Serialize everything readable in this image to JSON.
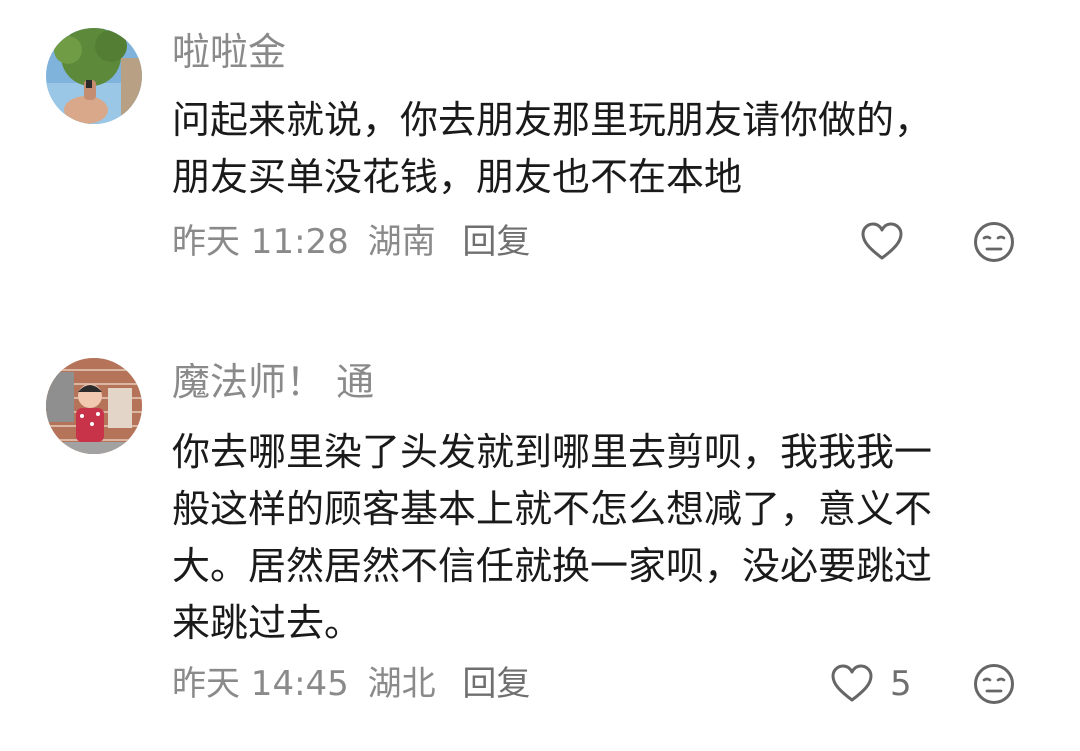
{
  "comments": [
    {
      "username": "啦啦金",
      "lines": [
        "问起来就说，你去朋友那里玩朋友请你做的，",
        "朋友买单没花钱，朋友也不在本地"
      ],
      "time": "昨天 11:28",
      "location": "湖南",
      "reply_label": "回复",
      "likes": "",
      "like_icon": "heart-outline-icon",
      "react_icon": "neutral-face-icon"
    },
    {
      "username": "魔法师！ 通",
      "lines": [
        "你去哪里染了头发就到哪里去剪呗，我我我一",
        "般这样的顾客基本上就不怎么想减了，意义不",
        "大。居然居然不信任就换一家呗，没必要跳过",
        "来跳过去。"
      ],
      "time": "昨天 14:45",
      "location": "湖北",
      "reply_label": "回复",
      "likes": "5",
      "like_icon": "heart-outline-icon",
      "react_icon": "neutral-face-icon"
    }
  ],
  "colors": {
    "text_primary": "#1a1a1a",
    "text_secondary": "#8a8a8a",
    "icon_stroke": "#666666"
  }
}
